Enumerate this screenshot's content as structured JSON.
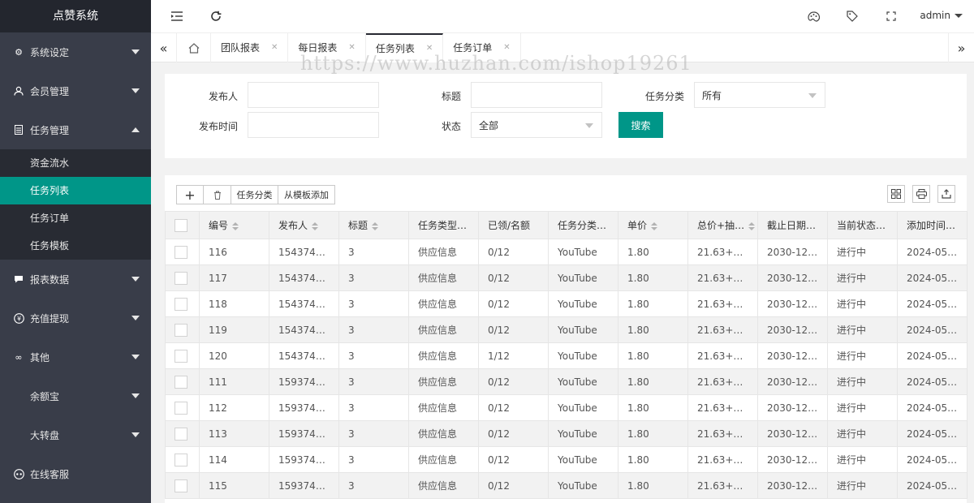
{
  "app": {
    "title": "点赞系统"
  },
  "sidebar": {
    "items": [
      {
        "label": "系统设定",
        "icon": "gear-icon"
      },
      {
        "label": "会员管理",
        "icon": "user-icon"
      },
      {
        "label": "任务管理",
        "icon": "document-icon",
        "expanded": true,
        "children": [
          "资金流水",
          "任务列表",
          "任务订单",
          "任务模板"
        ],
        "active_child": "任务列表"
      },
      {
        "label": "报表数据",
        "icon": "chat-icon"
      },
      {
        "label": "充值提现",
        "icon": "yen-icon"
      },
      {
        "label": "其他",
        "icon": "infinity-icon"
      },
      {
        "label": "余额宝",
        "icon": ""
      },
      {
        "label": "大转盘",
        "icon": ""
      },
      {
        "label": "在线客服",
        "icon": "support-icon"
      }
    ]
  },
  "header": {
    "user": "admin"
  },
  "tabs": [
    {
      "label": "团队报表"
    },
    {
      "label": "每日报表"
    },
    {
      "label": "任务列表",
      "active": true
    },
    {
      "label": "任务订单"
    }
  ],
  "watermark": "https://www.huzhan.com/ishop19261",
  "search": {
    "publisher_label": "发布人",
    "title_label": "标题",
    "category_label": "任务分类",
    "category_value": "所有",
    "time_label": "发布时间",
    "status_label": "状态",
    "status_value": "全部",
    "search_button": "搜索"
  },
  "toolbar": {
    "add": "+",
    "delete": "🗑",
    "category": "任务分类",
    "from_template": "从模板添加"
  },
  "table": {
    "columns": [
      "编号",
      "发布人",
      "标题",
      "任务类型…",
      "已领/名额",
      "任务分类…",
      "单价",
      "总价+抽水",
      "截止日期…",
      "当前状态…",
      "添加时间…"
    ],
    "rows": [
      [
        "116",
        "1543745…",
        "3",
        "供应信息",
        "0/12",
        "YouTube",
        "1.80",
        "21.63+0.…",
        "2030-12…",
        "进行中",
        "2024-05…"
      ],
      [
        "117",
        "1543745…",
        "3",
        "供应信息",
        "0/12",
        "YouTube",
        "1.80",
        "21.63+0.…",
        "2030-12…",
        "进行中",
        "2024-05…"
      ],
      [
        "118",
        "1543745…",
        "3",
        "供应信息",
        "0/12",
        "YouTube",
        "1.80",
        "21.63+0.…",
        "2030-12…",
        "进行中",
        "2024-05…"
      ],
      [
        "119",
        "1543745…",
        "3",
        "供应信息",
        "0/12",
        "YouTube",
        "1.80",
        "21.63+0.…",
        "2030-12…",
        "进行中",
        "2024-05…"
      ],
      [
        "120",
        "1543745…",
        "3",
        "供应信息",
        "1/12",
        "YouTube",
        "1.80",
        "21.63+0.…",
        "2030-12…",
        "进行中",
        "2024-05…"
      ],
      [
        "111",
        "1593745…",
        "3",
        "供应信息",
        "0/12",
        "YouTube",
        "1.80",
        "21.63+0.…",
        "2030-12…",
        "进行中",
        "2024-05…"
      ],
      [
        "112",
        "1593745…",
        "3",
        "供应信息",
        "0/12",
        "YouTube",
        "1.80",
        "21.63+0.…",
        "2030-12…",
        "进行中",
        "2024-05…"
      ],
      [
        "113",
        "1593745…",
        "3",
        "供应信息",
        "0/12",
        "YouTube",
        "1.80",
        "21.63+0.…",
        "2030-12…",
        "进行中",
        "2024-05…"
      ],
      [
        "114",
        "1593745…",
        "3",
        "供应信息",
        "0/12",
        "YouTube",
        "1.80",
        "21.63+0.…",
        "2030-12…",
        "进行中",
        "2024-05…"
      ],
      [
        "115",
        "1593745…",
        "3",
        "供应信息",
        "0/12",
        "YouTube",
        "1.80",
        "21.63+0.…",
        "2030-12…",
        "进行中",
        "2024-05…"
      ]
    ]
  },
  "colors": {
    "accent": "#009688",
    "sidebar_bg": "#393d49",
    "logo_bg": "#23262e"
  }
}
